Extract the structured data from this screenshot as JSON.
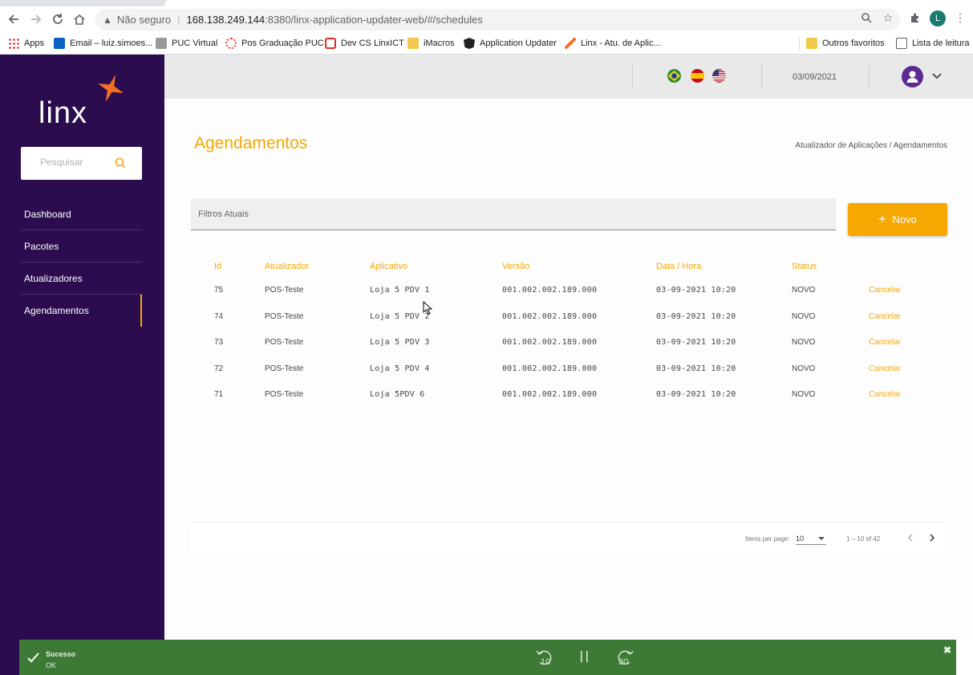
{
  "browser": {
    "not_secure": "Não seguro",
    "url_host": "168.138.249.144",
    "url_rest": ":8380/linx-application-updater-web/#/schedules",
    "profile_initial": "L"
  },
  "bookmarks": [
    {
      "label": "Apps",
      "color": "#e8453c"
    },
    {
      "label": "Email – luiz.simoes...",
      "color": "#0a64c8"
    },
    {
      "label": "PUC Virtual",
      "color": "#8a8a8a"
    },
    {
      "label": "Pos Graduação PUC",
      "color": "#e8453c"
    },
    {
      "label": "Dev CS LinxICT",
      "color": "#d93025"
    },
    {
      "label": "iMacros",
      "color": "#f2c94c"
    },
    {
      "label": "Application Updater",
      "color": "#202124"
    },
    {
      "label": "Linx - Atu. de Aplic...",
      "color": "#f36f21"
    }
  ],
  "bookmarks_right": [
    {
      "label": "Outros favoritos"
    },
    {
      "label": "Lista de leitura"
    }
  ],
  "sidebar": {
    "logo_text": "linx",
    "search_placeholder": "Pesquisar",
    "items": [
      {
        "label": "Dashboard"
      },
      {
        "label": "Pacotes"
      },
      {
        "label": "Atualizadores"
      },
      {
        "label": "Agendamentos",
        "active": true
      }
    ]
  },
  "header": {
    "date": "03/09/2021"
  },
  "page": {
    "title": "Agendamentos",
    "breadcrumb": "Atualizador de Aplicações / Agendamentos",
    "filter_label": "Filtros Atuais",
    "new_button": "Novo"
  },
  "table": {
    "columns": [
      "Id",
      "Atualizador",
      "Aplicativo",
      "Versão",
      "Data / Hora",
      "Status"
    ],
    "rows": [
      {
        "id": "75",
        "updater": "POS-Teste",
        "app": "Loja 5 PDV 1",
        "version": "001.002.002.189.000",
        "datetime": "03-09-2021 10:20",
        "status": "NOVO",
        "action": "Cancelar"
      },
      {
        "id": "74",
        "updater": "POS-Teste",
        "app": "Loja 5 PDV 2",
        "version": "001.002.002.189.000",
        "datetime": "03-09-2021 10:20",
        "status": "NOVO",
        "action": "Cancelar"
      },
      {
        "id": "73",
        "updater": "POS-Teste",
        "app": "Loja 5 PDV 3",
        "version": "001.002.002.189.000",
        "datetime": "03-09-2021 10:20",
        "status": "NOVO",
        "action": "Cancelar"
      },
      {
        "id": "72",
        "updater": "POS-Teste",
        "app": "Loja 5 PDV 4",
        "version": "001.002.002.189.000",
        "datetime": "03-09-2021 10:20",
        "status": "NOVO",
        "action": "Cancelar"
      },
      {
        "id": "71",
        "updater": "POS-Teste",
        "app": "Loja 5PDV 6",
        "version": "001.002.002.189.000",
        "datetime": "03-09-2021 10:20",
        "status": "NOVO",
        "action": "Cancelar"
      }
    ]
  },
  "paginator": {
    "items_label": "Items per page:",
    "page_size": "10",
    "range": "1 – 10 of 42"
  },
  "toast": {
    "title": "Sucesso",
    "message": "OK",
    "rewind_label": "10",
    "forward_label": "30"
  },
  "colors": {
    "accent": "#f6a800",
    "sidebar": "#2b0d4f",
    "toast": "#3d7a36"
  }
}
